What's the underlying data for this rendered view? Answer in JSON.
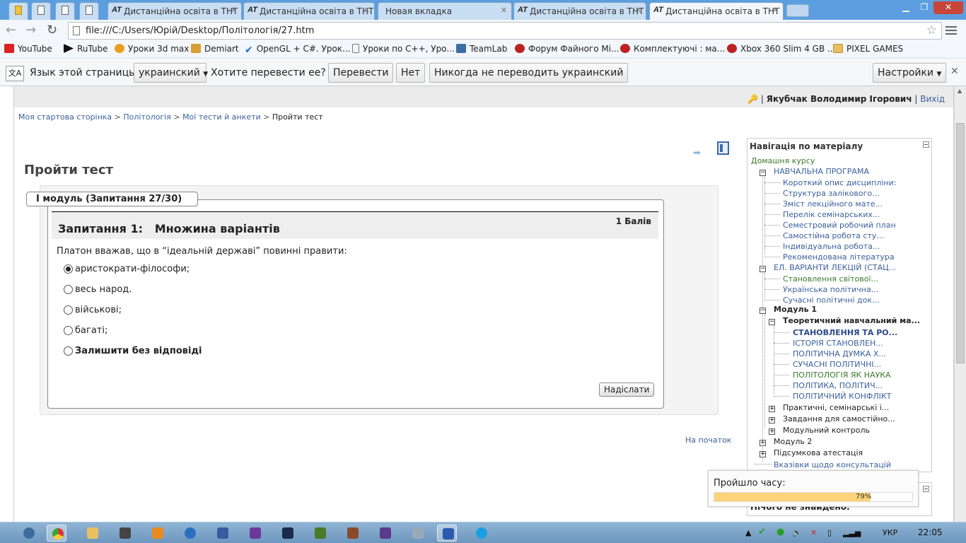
{
  "browser": {
    "tabs": [
      {
        "icon": "AT",
        "title": "Дистанційна освіта в ТНТ"
      },
      {
        "icon": "AT",
        "title": "Дистанційна освіта в ТНТ"
      },
      {
        "icon": "",
        "title": "Новая вкладка"
      },
      {
        "icon": "AT",
        "title": "Дистанційна освіта в ТНТ"
      },
      {
        "icon": "AT",
        "title": "Дистанційна освіта в ТНТ"
      }
    ],
    "url": "file:///C:/Users/Юрій/Desktop/Політологія/27.htm",
    "bookmarks": [
      "YouTube",
      "RuTube",
      "Уроки 3d max",
      "Demiart",
      "OpenGL + C#. Урок...",
      "Уроки по C++, Уро...",
      "TeamLab",
      "Форум Файного Мі...",
      "Комплектуючі : ма...",
      "Xbox 360 Slim 4 GB ...",
      "PIXEL GAMES"
    ],
    "translate": {
      "label": "Язык этой страницы",
      "language": "украинский",
      "question": "Хотите перевести ее?",
      "translate_btn": "Перевести",
      "no_btn": "Нет",
      "never_btn": "Никогда не переводить украинский",
      "settings_btn": "Настройки"
    }
  },
  "page": {
    "user": "Якубчак Володимир Ігорович",
    "logout": "Вихід",
    "breadcrumbs": [
      "Моя стартова сторінка",
      "Політологія",
      "Мої тести й анкети"
    ],
    "breadcrumb_current": "Пройти тест",
    "title": "Пройти тест",
    "legend": "I модуль (Запитання 27/30)",
    "question_no": "Запитання 1:",
    "question_type": "Множина варіантів",
    "marks": "1 Балів",
    "question_text": "Платон вважав, що в “ідеальній державі” повинні правити:",
    "options": [
      "аристократи-філософи;",
      "весь народ.",
      "військові;",
      "багаті;",
      "Залишити без відповіді"
    ],
    "selected_option": 0,
    "submit": "Надіслати",
    "to_top": "На початок"
  },
  "nav": {
    "header": "Навігація по матеріалу",
    "home": "Домашня курсу",
    "program": "НАВЧАЛЬНА ПРОГРАМА",
    "program_items": [
      "Короткий опис дисципліни:",
      "Структура залікового...",
      "Зміст лекційного мате...",
      "Перелік семінарських...",
      "Семестровий робочий план",
      "Самостійна робота сту...",
      "Індивідуальна робота...",
      "Рекомендована література"
    ],
    "lectures": "ЕЛ. ВАРІАНТИ ЛЕКЦІЙ (СТАЦ...",
    "lecture_items": [
      "Становлення світової...",
      "Українська політична...",
      "Сучасні політичні док..."
    ],
    "module1": "Модуль 1",
    "theory": "Теоретичний навчальний ма...",
    "theory_items": [
      "СТАНОВЛЕННЯ ТА РО...",
      "ІСТОРІЯ СТАНОВЛЕН...",
      "ПОЛІТИЧНА ДУМКА Х...",
      "СУЧАСНІ ПОЛІТИЧНІ...",
      "ПОЛІТОЛОГІЯ ЯК НАУКА",
      "ПОЛІТИКА, ПОЛІТИЧ...",
      "ПОЛІТИЧНИЙ КОНФЛІКТ"
    ],
    "m1_items": [
      "Практичні, семінарські і...",
      "Завдання для самостійно...",
      "Модульний контроль"
    ],
    "module2": "Модуль 2",
    "final": "Підсумкова атестація",
    "consult": "Вказівки щодо консультацій"
  },
  "timer": {
    "label": "Пройшло часу:",
    "percent_text": "79%",
    "fraction": 0.79
  },
  "block2_text": "Нічого не знайдено.",
  "system": {
    "lang": "УКР",
    "time": "22:05"
  }
}
